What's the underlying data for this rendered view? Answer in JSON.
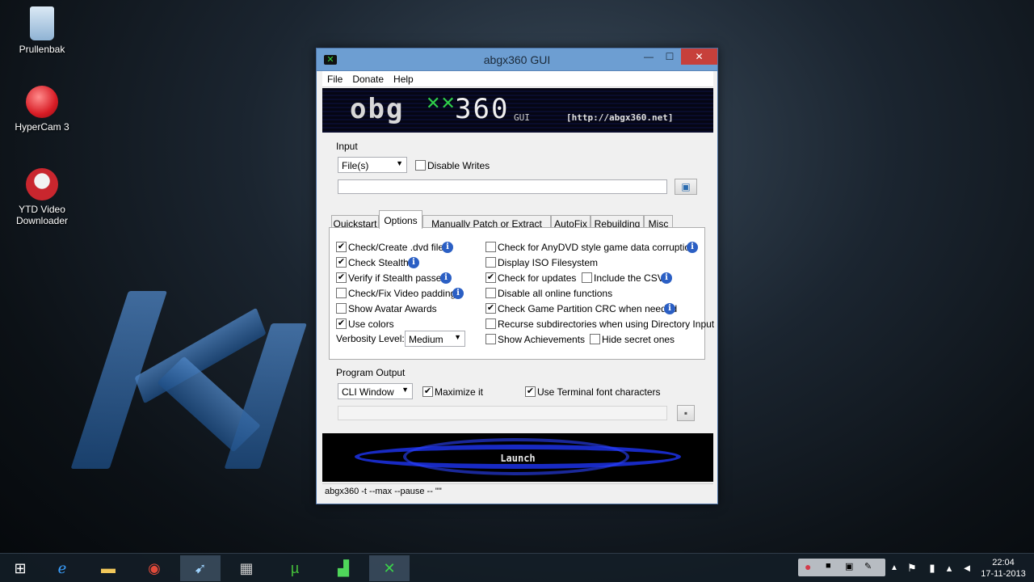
{
  "desktop": {
    "icons": [
      {
        "label": "Prullenbak",
        "color": "#9fc6e8"
      },
      {
        "label": "HyperCam 3",
        "color": "#e8343a"
      },
      {
        "label": "YTD Video Downloader",
        "color": "#c9262e"
      }
    ]
  },
  "window": {
    "title": "abgx360 GUI",
    "controls": {
      "minimize": "—",
      "maximize": "☐",
      "close": "✕"
    },
    "menu": [
      "File",
      "Donate",
      "Help"
    ],
    "banner": {
      "logo": "obg",
      "logo_tail": "360",
      "gui": "GUI",
      "url": "[http://abgx360.net]"
    },
    "input": {
      "group_label": "Input",
      "source_select": "File(s)",
      "disable_writes": {
        "label": "Disable Writes",
        "checked": false
      },
      "path_value": ""
    },
    "tabs": [
      "Quickstart",
      "Options",
      "Manually Patch or Extract Files",
      "AutoFix",
      "Rebuilding",
      "Misc"
    ],
    "active_tab": "Options",
    "options_left": [
      {
        "label": "Check/Create .dvd file",
        "checked": true,
        "info": true
      },
      {
        "label": "Check Stealth",
        "checked": true,
        "info": true
      },
      {
        "label": "Verify if Stealth passes",
        "checked": true,
        "info": true
      },
      {
        "label": "Check/Fix Video padding",
        "checked": false,
        "info": true
      },
      {
        "label": "Show Avatar Awards",
        "checked": false,
        "info": false
      },
      {
        "label": "Use colors",
        "checked": true,
        "info": false
      }
    ],
    "verbosity": {
      "label": "Verbosity Level:",
      "value": "Medium"
    },
    "options_right": [
      {
        "label": "Check for AnyDVD style game data corruption",
        "checked": false,
        "info": true
      },
      {
        "label": "Display ISO Filesystem",
        "checked": false,
        "info": false
      },
      {
        "label": "Check for updates",
        "checked": true,
        "info": false
      },
      {
        "label": "Disable all online functions",
        "checked": false,
        "info": false
      },
      {
        "label": "Check Game Partition CRC when needed",
        "checked": true,
        "info": true
      },
      {
        "label": "Recurse subdirectories when using Directory Input",
        "checked": false,
        "info": false
      },
      {
        "label": "Show Achievements",
        "checked": false,
        "info": false
      }
    ],
    "include_csv": {
      "label": "Include the CSV",
      "checked": false
    },
    "hide_secret": {
      "label": "Hide secret ones",
      "checked": false
    },
    "output": {
      "group_label": "Program Output",
      "mode_select": "CLI Window",
      "maximize": {
        "label": "Maximize it",
        "checked": true
      },
      "terminal_font": {
        "label": "Use Terminal font characters",
        "checked": true
      }
    },
    "launch_label": "Launch",
    "status_text": "abgx360 -t --max --pause -- \"\""
  },
  "taskbar": {
    "clock_time": "22:04",
    "clock_date": "17-11-2013"
  }
}
